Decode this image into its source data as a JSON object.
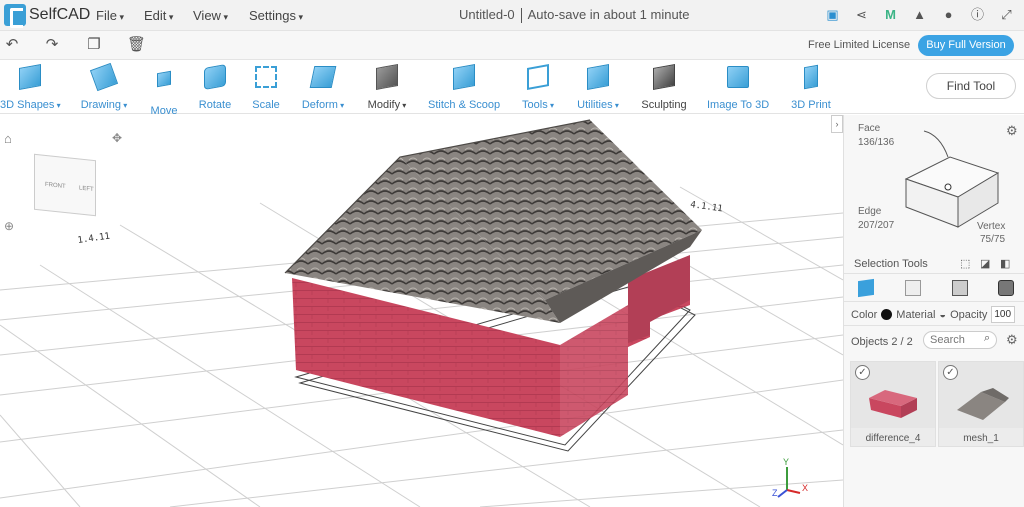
{
  "app": {
    "name": "SelfCAD"
  },
  "menu": [
    "File",
    "Edit",
    "View",
    "Settings"
  ],
  "document": {
    "title": "Untitled-0",
    "autosave": "Auto-save in about 1 minute"
  },
  "license": {
    "text": "Free Limited License",
    "buy_label": "Buy Full Version"
  },
  "toolbar": {
    "items": [
      {
        "label": "3D Shapes"
      },
      {
        "label": "Drawing"
      },
      {
        "label": "Move"
      },
      {
        "label": "Rotate"
      },
      {
        "label": "Scale"
      },
      {
        "label": "Deform"
      },
      {
        "label": "Modify"
      },
      {
        "label": "Stitch & Scoop"
      },
      {
        "label": "Tools"
      },
      {
        "label": "Utilities"
      },
      {
        "label": "Sculpting"
      },
      {
        "label": "Image To 3D"
      },
      {
        "label": "3D Print"
      }
    ],
    "find_tool": "Find Tool"
  },
  "viewcube": {
    "front": "FRONT",
    "right": "LEFT"
  },
  "panel": {
    "face_label": "Face",
    "face_count": "136/136",
    "edge_label": "Edge",
    "edge_count": "207/207",
    "vertex_label": "Vertex",
    "vertex_count": "75/75",
    "selection_tools": "Selection Tools",
    "color_label": "Color",
    "material_label": "Material",
    "opacity_label": "Opacity",
    "opacity_value": "100",
    "objects_label": "Objects 2 / 2",
    "search_placeholder": "Search",
    "objects": [
      {
        "name": "difference_4"
      },
      {
        "name": "mesh_1"
      }
    ]
  },
  "axes": {
    "x": "X",
    "y": "Y",
    "z": "Z"
  },
  "colors": {
    "accent": "#3ba3e4",
    "wall": "#c7455e",
    "roof": "#77736f"
  }
}
